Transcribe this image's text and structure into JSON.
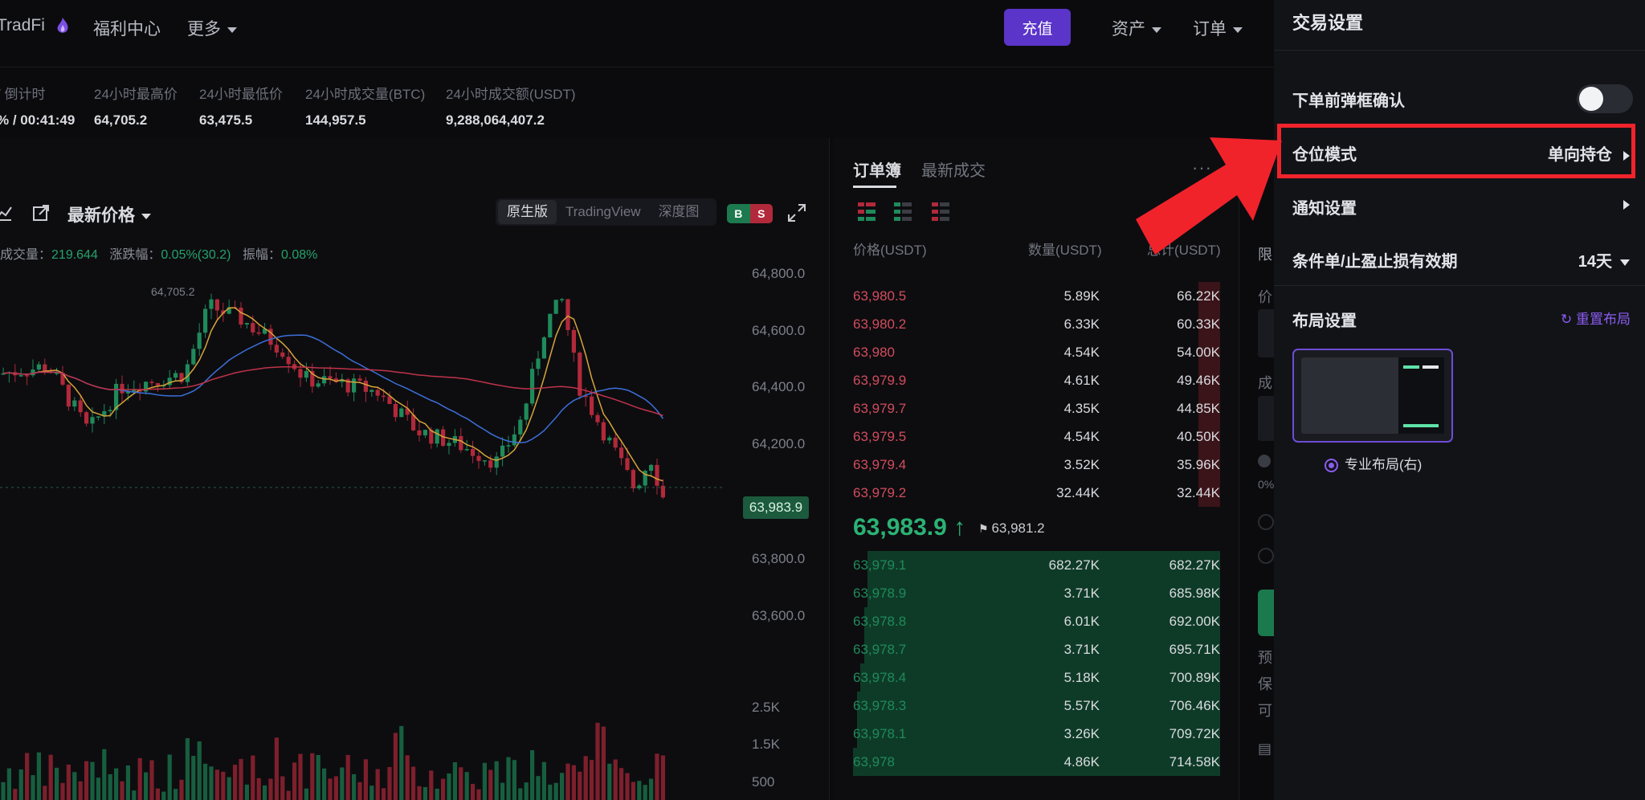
{
  "header": {
    "brand_partial": "TradFi",
    "nav": {
      "welfare": "福利中心",
      "more": "更多",
      "assets": "资产",
      "orders": "订单"
    },
    "deposit_label": "充值"
  },
  "stats": [
    {
      "label": "/ 倒计时",
      "value": "% / 00:41:49"
    },
    {
      "label": "24小时最高价",
      "value": "64,705.2"
    },
    {
      "label": "24小时最低价",
      "value": "63,475.5"
    },
    {
      "label": "24小时成交量(BTC)",
      "value": "144,957.5"
    },
    {
      "label": "24小时成交额(USDT)",
      "value": "9,288,064,407.2"
    }
  ],
  "chart": {
    "price_type": "最新价格",
    "views": [
      "原生版",
      "TradingView",
      "深度图"
    ],
    "active_view": "原生版",
    "bs_toggle": {
      "b": "B",
      "s": "S"
    },
    "info": {
      "volume_label": "成交量：",
      "volume": "219.644",
      "change_label": "涨跌幅：",
      "change": "0.05%(30.2)",
      "amp_label": "振幅：",
      "amp": "0.08%"
    },
    "high_marker": "64,705.2",
    "last_price": "63,983.9",
    "y_ticks": [
      "64,800.0",
      "64,600.0",
      "64,400.0",
      "64,200.0",
      "63,800.0",
      "63,600.0"
    ],
    "vol_ticks": [
      "2.5K",
      "1.5K",
      "500"
    ],
    "colors": {
      "up": "#1f8a5a",
      "down": "#b1293a",
      "ma_yellow": "#d6a43a",
      "ma_blue": "#3d6fd8",
      "ma_red": "#c0334a"
    }
  },
  "chart_data": {
    "type": "candlestick",
    "y_range": [
      63500,
      64800
    ],
    "last_price": 63983.9,
    "high": 64705.2
  },
  "orderbook": {
    "tabs": [
      "订单簿",
      "最新成交"
    ],
    "headers": {
      "price": "价格(USDT)",
      "qty": "数量(USDT)",
      "total": "总计(USDT)"
    },
    "asks": [
      {
        "price": "63,980.5",
        "qty": "5.89K",
        "total": "66.22K",
        "depth": 0.06
      },
      {
        "price": "63,980.2",
        "qty": "6.33K",
        "total": "60.33K",
        "depth": 0.06
      },
      {
        "price": "63,980",
        "qty": "4.54K",
        "total": "54.00K",
        "depth": 0.06
      },
      {
        "price": "63,979.9",
        "qty": "4.61K",
        "total": "49.46K",
        "depth": 0.06
      },
      {
        "price": "63,979.7",
        "qty": "4.35K",
        "total": "44.85K",
        "depth": 0.06
      },
      {
        "price": "63,979.5",
        "qty": "4.54K",
        "total": "40.50K",
        "depth": 0.06
      },
      {
        "price": "63,979.4",
        "qty": "3.52K",
        "total": "35.96K",
        "depth": 0.06
      },
      {
        "price": "63,979.2",
        "qty": "32.44K",
        "total": "32.44K",
        "depth": 0.06
      }
    ],
    "mid_price": "63,983.9 ↑",
    "mark_price": "63,981.2",
    "bids": [
      {
        "price": "63,979.1",
        "qty": "682.27K",
        "total": "682.27K",
        "depth": 0.96
      },
      {
        "price": "63,978.9",
        "qty": "3.71K",
        "total": "685.98K",
        "depth": 0.96
      },
      {
        "price": "63,978.8",
        "qty": "6.01K",
        "total": "692.00K",
        "depth": 0.97
      },
      {
        "price": "63,978.7",
        "qty": "3.71K",
        "total": "695.71K",
        "depth": 0.97
      },
      {
        "price": "63,978.4",
        "qty": "5.18K",
        "total": "700.89K",
        "depth": 0.98
      },
      {
        "price": "63,978.3",
        "qty": "5.57K",
        "total": "706.46K",
        "depth": 0.99
      },
      {
        "price": "63,978.1",
        "qty": "3.26K",
        "total": "709.72K",
        "depth": 0.99
      },
      {
        "price": "63,978",
        "qty": "4.86K",
        "total": "714.58K",
        "depth": 1.0
      }
    ]
  },
  "trade_fade": {
    "limit": "限",
    "price": "价",
    "deal": "成",
    "pct": "0%",
    "pre": "预",
    "bao": "保",
    "ke": "可"
  },
  "settings": {
    "title": "交易设置",
    "confirm_label": "下单前弹框确认",
    "confirm_enabled": false,
    "position_mode_label": "仓位模式",
    "position_mode_value": "单向持仓",
    "notify_label": "通知设置",
    "validity_label": "条件单/止盈止损有效期",
    "validity_value": "14天",
    "layout_label": "布局设置",
    "reset_layout": "重置布局",
    "layout_option": "专业布局(右)",
    "accent": "#8a5cf0"
  }
}
